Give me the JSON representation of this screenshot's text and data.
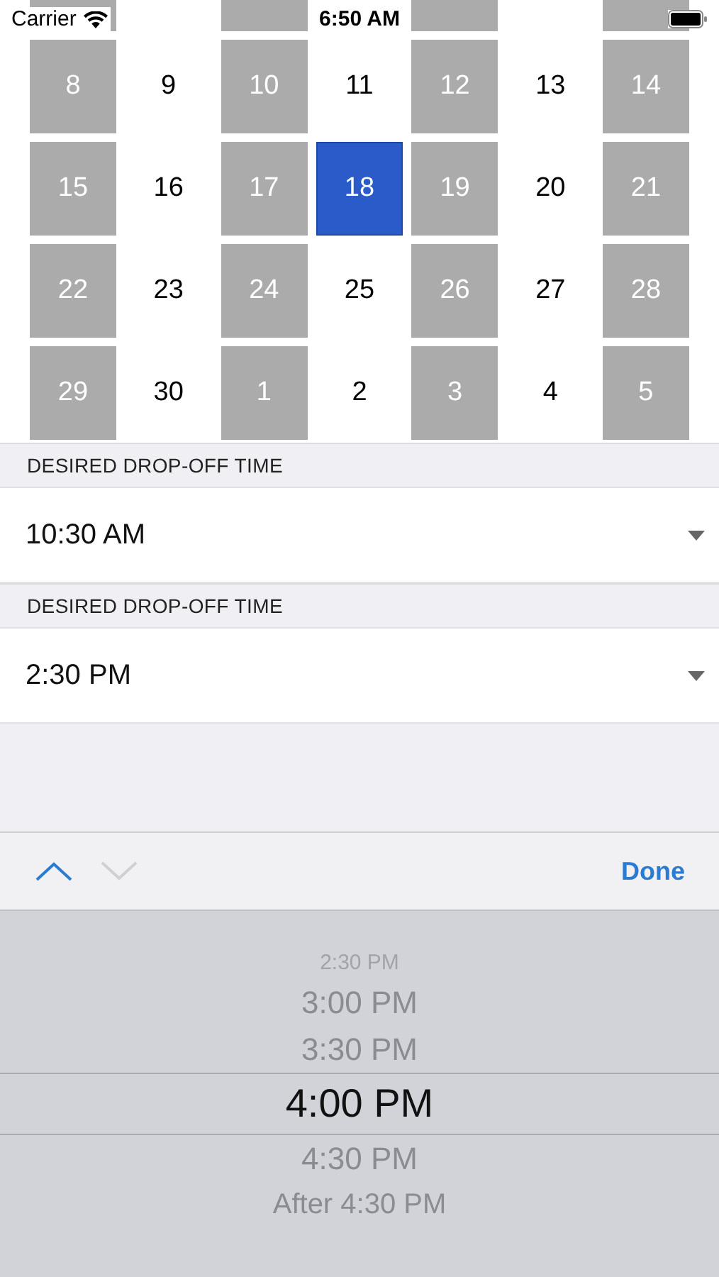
{
  "status_bar": {
    "carrier": "Carrier",
    "time": "6:50 AM"
  },
  "calendar": {
    "weeks": [
      [
        {
          "day": "8",
          "disabled": true,
          "selected": false
        },
        {
          "day": "9",
          "disabled": false,
          "selected": false
        },
        {
          "day": "10",
          "disabled": true,
          "selected": false
        },
        {
          "day": "11",
          "disabled": false,
          "selected": false
        },
        {
          "day": "12",
          "disabled": true,
          "selected": false
        },
        {
          "day": "13",
          "disabled": false,
          "selected": false
        },
        {
          "day": "14",
          "disabled": true,
          "selected": false
        }
      ],
      [
        {
          "day": "15",
          "disabled": true,
          "selected": false
        },
        {
          "day": "16",
          "disabled": false,
          "selected": false
        },
        {
          "day": "17",
          "disabled": true,
          "selected": false
        },
        {
          "day": "18",
          "disabled": false,
          "selected": true
        },
        {
          "day": "19",
          "disabled": true,
          "selected": false
        },
        {
          "day": "20",
          "disabled": false,
          "selected": false
        },
        {
          "day": "21",
          "disabled": true,
          "selected": false
        }
      ],
      [
        {
          "day": "22",
          "disabled": true,
          "selected": false
        },
        {
          "day": "23",
          "disabled": false,
          "selected": false
        },
        {
          "day": "24",
          "disabled": true,
          "selected": false
        },
        {
          "day": "25",
          "disabled": false,
          "selected": false
        },
        {
          "day": "26",
          "disabled": true,
          "selected": false
        },
        {
          "day": "27",
          "disabled": false,
          "selected": false
        },
        {
          "day": "28",
          "disabled": true,
          "selected": false
        }
      ],
      [
        {
          "day": "29",
          "disabled": true,
          "selected": false
        },
        {
          "day": "30",
          "disabled": false,
          "selected": false
        },
        {
          "day": "1",
          "disabled": true,
          "selected": false
        },
        {
          "day": "2",
          "disabled": false,
          "selected": false
        },
        {
          "day": "3",
          "disabled": true,
          "selected": false
        },
        {
          "day": "4",
          "disabled": false,
          "selected": false
        },
        {
          "day": "5",
          "disabled": true,
          "selected": false
        }
      ]
    ]
  },
  "sections": [
    {
      "header": "DESIRED DROP-OFF TIME",
      "value": "10:30 AM"
    },
    {
      "header": "DESIRED DROP-OFF TIME",
      "value": "2:30 PM"
    }
  ],
  "toolbar": {
    "previous_disabled": false,
    "next_disabled": true,
    "done": "Done"
  },
  "picker": {
    "items": [
      {
        "label": "2:30 PM",
        "selected": false
      },
      {
        "label": "3:00 PM",
        "selected": false
      },
      {
        "label": "3:30 PM",
        "selected": false
      },
      {
        "label": "4:00 PM",
        "selected": true
      },
      {
        "label": "4:30 PM",
        "selected": false
      },
      {
        "label": "After 4:30 PM",
        "selected": false
      }
    ]
  }
}
